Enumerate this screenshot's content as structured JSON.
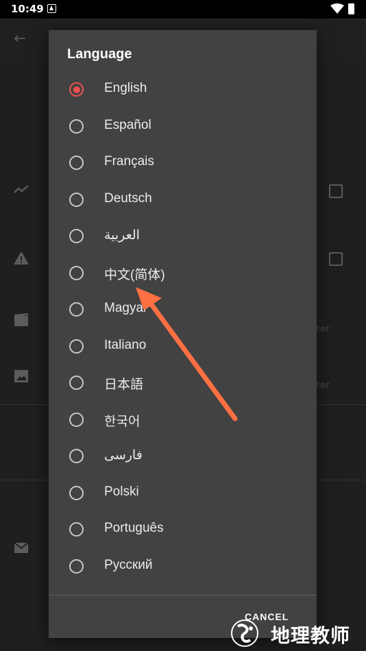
{
  "status_bar": {
    "time": "10:49",
    "icons": [
      "notification-a-icon",
      "wifi-icon",
      "battery-icon"
    ]
  },
  "background_app": {
    "back_icon": "arrow-back-icon",
    "icons": [
      "trend-icon",
      "warning-icon",
      "movie-icon",
      "image-icon",
      "mail-icon"
    ],
    "faint_text": [
      "ter",
      "ter"
    ]
  },
  "dialog": {
    "title": "Language",
    "options": [
      {
        "label": "English",
        "selected": true
      },
      {
        "label": "Español",
        "selected": false
      },
      {
        "label": "Français",
        "selected": false
      },
      {
        "label": "Deutsch",
        "selected": false
      },
      {
        "label": "العربية",
        "selected": false
      },
      {
        "label": "中文(简体)",
        "selected": false
      },
      {
        "label": "Magyar",
        "selected": false
      },
      {
        "label": "Italiano",
        "selected": false
      },
      {
        "label": "日本語",
        "selected": false
      },
      {
        "label": "한국어",
        "selected": false
      },
      {
        "label": "فارسی",
        "selected": false
      },
      {
        "label": "Polski",
        "selected": false
      },
      {
        "label": "Português",
        "selected": false
      },
      {
        "label": "Русский",
        "selected": false
      },
      {
        "label": "",
        "selected": false
      }
    ],
    "cancel_label": "CANCEL"
  },
  "annotation": {
    "arrow_color": "#ff7043",
    "points_to": "中文(简体)"
  },
  "watermark": {
    "text": "地理教师",
    "icon": "globe-logo-icon"
  },
  "colors": {
    "accent": "#ef5350",
    "dialog_bg": "#424242"
  }
}
